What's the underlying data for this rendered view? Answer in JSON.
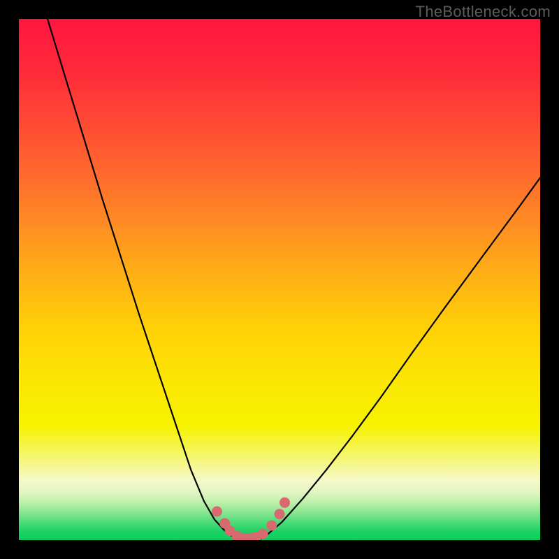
{
  "watermark": "TheBottleneck.com",
  "gradient_stops": [
    {
      "offset": 0.0,
      "color": "#ff163f"
    },
    {
      "offset": 0.1,
      "color": "#ff2a3b"
    },
    {
      "offset": 0.2,
      "color": "#ff4a34"
    },
    {
      "offset": 0.3,
      "color": "#ff6a2d"
    },
    {
      "offset": 0.4,
      "color": "#ff8f22"
    },
    {
      "offset": 0.5,
      "color": "#ffb314"
    },
    {
      "offset": 0.6,
      "color": "#ffd207"
    },
    {
      "offset": 0.7,
      "color": "#fbe703"
    },
    {
      "offset": 0.78,
      "color": "#f6f200"
    },
    {
      "offset": 0.84,
      "color": "#f5f66e"
    },
    {
      "offset": 0.885,
      "color": "#f6f8c8"
    },
    {
      "offset": 0.905,
      "color": "#e6f6c5"
    },
    {
      "offset": 0.925,
      "color": "#c3f0ae"
    },
    {
      "offset": 0.945,
      "color": "#8fe793"
    },
    {
      "offset": 0.965,
      "color": "#4fdc79"
    },
    {
      "offset": 0.985,
      "color": "#18d264"
    },
    {
      "offset": 1.0,
      "color": "#0fcc5d"
    }
  ],
  "marker_color": "#d76a6f",
  "curve_color": "#000000",
  "chart_data": {
    "type": "line",
    "title": "",
    "xlabel": "",
    "ylabel": "",
    "xlim": [
      0,
      1
    ],
    "ylim": [
      0,
      1
    ],
    "description": "Bottleneck percentage vs. component ratio. Y axis is bottleneck (0 at bottom, 1 at top). The curve dips to ~0 near x≈0.43 marking the balanced point; colored background encodes severity (green=good near bottom, red=bad near top).",
    "series": [
      {
        "name": "left-branch",
        "x": [
          0.055,
          0.09,
          0.125,
          0.16,
          0.195,
          0.23,
          0.265,
          0.3,
          0.33,
          0.355,
          0.375,
          0.395,
          0.412
        ],
        "y": [
          1.0,
          0.885,
          0.77,
          0.655,
          0.545,
          0.435,
          0.33,
          0.225,
          0.135,
          0.075,
          0.04,
          0.018,
          0.005
        ]
      },
      {
        "name": "valley",
        "x": [
          0.412,
          0.425,
          0.44,
          0.455,
          0.47
        ],
        "y": [
          0.005,
          0.0,
          0.0,
          0.0,
          0.005
        ]
      },
      {
        "name": "right-branch",
        "x": [
          0.47,
          0.505,
          0.545,
          0.59,
          0.64,
          0.695,
          0.755,
          0.82,
          0.89,
          0.96,
          1.0
        ],
        "y": [
          0.005,
          0.035,
          0.08,
          0.135,
          0.2,
          0.275,
          0.36,
          0.45,
          0.545,
          0.64,
          0.695
        ]
      }
    ],
    "markers": {
      "name": "valley-dots",
      "x": [
        0.38,
        0.395,
        0.405,
        0.418,
        0.43,
        0.442,
        0.455,
        0.468,
        0.485,
        0.5,
        0.51
      ],
      "y": [
        0.055,
        0.032,
        0.018,
        0.008,
        0.004,
        0.004,
        0.006,
        0.012,
        0.028,
        0.05,
        0.072
      ]
    }
  }
}
